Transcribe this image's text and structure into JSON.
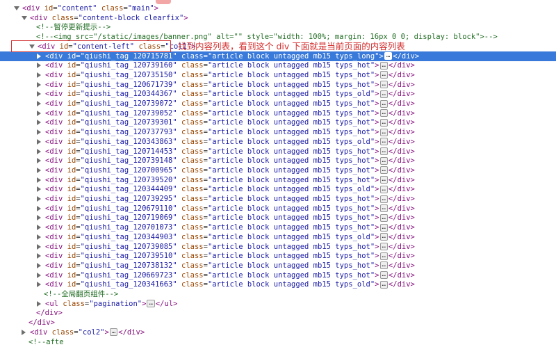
{
  "lines": [
    {
      "indent": 0,
      "tri": "open",
      "kind": "open",
      "tag": "div",
      "attrs": [
        {
          "n": "id",
          "v": "\"content\""
        },
        {
          "n": "class",
          "v": "\"main\""
        }
      ]
    },
    {
      "indent": 1,
      "tri": "open",
      "kind": "open",
      "tag": "div",
      "attrs": [
        {
          "n": "class",
          "v": "\"content-block clearfix\""
        }
      ]
    },
    {
      "indent": 2,
      "tri": "none",
      "kind": "comment",
      "text": "<!--暂停更新提示-->"
    },
    {
      "indent": 2,
      "tri": "none",
      "kind": "comment",
      "text": "<!--<img src=\"/static/images/banner.png\" alt=\"\" style=\"width: 100%; margin: 16px 0 0; display: block\">-->"
    },
    {
      "indent": 2,
      "tri": "open",
      "kind": "open",
      "tag": "div",
      "attrs": [
        {
          "n": "id",
          "v": "\"content-left\""
        },
        {
          "n": "class",
          "v": "\"col1\""
        }
      ]
    },
    {
      "indent": 3,
      "tri": "closed",
      "kind": "collapsed",
      "hl": true,
      "tag": "div",
      "attrs": [
        {
          "n": "id",
          "v": "\"qiushi_tag_120715781\""
        },
        {
          "n": "class",
          "v": "\"article block untagged mb15 typs_long\""
        }
      ]
    },
    {
      "indent": 3,
      "tri": "closed",
      "kind": "collapsed",
      "tag": "div",
      "attrs": [
        {
          "n": "id",
          "v": "\"qiushi_tag_120739160\""
        },
        {
          "n": "class",
          "v": "\"article block untagged mb15 typs_hot\""
        }
      ]
    },
    {
      "indent": 3,
      "tri": "closed",
      "kind": "collapsed",
      "tag": "div",
      "attrs": [
        {
          "n": "id",
          "v": "\"qiushi_tag_120735150\""
        },
        {
          "n": "class",
          "v": "\"article block untagged mb15 typs_hot\""
        }
      ]
    },
    {
      "indent": 3,
      "tri": "closed",
      "kind": "collapsed",
      "tag": "div",
      "attrs": [
        {
          "n": "id",
          "v": "\"qiushi_tag_120671739\""
        },
        {
          "n": "class",
          "v": "\"article block untagged mb15 typs_hot\""
        }
      ]
    },
    {
      "indent": 3,
      "tri": "closed",
      "kind": "collapsed",
      "tag": "div",
      "attrs": [
        {
          "n": "id",
          "v": "\"qiushi_tag_120344367\""
        },
        {
          "n": "class",
          "v": "\"article block untagged mb15 typs_old\""
        }
      ]
    },
    {
      "indent": 3,
      "tri": "closed",
      "kind": "collapsed",
      "tag": "div",
      "attrs": [
        {
          "n": "id",
          "v": "\"qiushi_tag_120739072\""
        },
        {
          "n": "class",
          "v": "\"article block untagged mb15 typs_hot\""
        }
      ]
    },
    {
      "indent": 3,
      "tri": "closed",
      "kind": "collapsed",
      "tag": "div",
      "attrs": [
        {
          "n": "id",
          "v": "\"qiushi_tag_120739052\""
        },
        {
          "n": "class",
          "v": "\"article block untagged mb15 typs_hot\""
        }
      ]
    },
    {
      "indent": 3,
      "tri": "closed",
      "kind": "collapsed",
      "tag": "div",
      "attrs": [
        {
          "n": "id",
          "v": "\"qiushi_tag_120739301\""
        },
        {
          "n": "class",
          "v": "\"article block untagged mb15 typs_hot\""
        }
      ]
    },
    {
      "indent": 3,
      "tri": "closed",
      "kind": "collapsed",
      "tag": "div",
      "attrs": [
        {
          "n": "id",
          "v": "\"qiushi_tag_120737793\""
        },
        {
          "n": "class",
          "v": "\"article block untagged mb15 typs_hot\""
        }
      ]
    },
    {
      "indent": 3,
      "tri": "closed",
      "kind": "collapsed",
      "tag": "div",
      "attrs": [
        {
          "n": "id",
          "v": "\"qiushi_tag_120343863\""
        },
        {
          "n": "class",
          "v": "\"article block untagged mb15 typs_old\""
        }
      ]
    },
    {
      "indent": 3,
      "tri": "closed",
      "kind": "collapsed",
      "tag": "div",
      "attrs": [
        {
          "n": "id",
          "v": "\"qiushi_tag_120714453\""
        },
        {
          "n": "class",
          "v": "\"article block untagged mb15 typs_hot\""
        }
      ]
    },
    {
      "indent": 3,
      "tri": "closed",
      "kind": "collapsed",
      "tag": "div",
      "attrs": [
        {
          "n": "id",
          "v": "\"qiushi_tag_120739148\""
        },
        {
          "n": "class",
          "v": "\"article block untagged mb15 typs_hot\""
        }
      ]
    },
    {
      "indent": 3,
      "tri": "closed",
      "kind": "collapsed",
      "tag": "div",
      "attrs": [
        {
          "n": "id",
          "v": "\"qiushi_tag_120700965\""
        },
        {
          "n": "class",
          "v": "\"article block untagged mb15 typs_hot\""
        }
      ]
    },
    {
      "indent": 3,
      "tri": "closed",
      "kind": "collapsed",
      "tag": "div",
      "attrs": [
        {
          "n": "id",
          "v": "\"qiushi_tag_120739520\""
        },
        {
          "n": "class",
          "v": "\"article block untagged mb15 typs_hot\""
        }
      ]
    },
    {
      "indent": 3,
      "tri": "closed",
      "kind": "collapsed",
      "tag": "div",
      "attrs": [
        {
          "n": "id",
          "v": "\"qiushi_tag_120344409\""
        },
        {
          "n": "class",
          "v": "\"article block untagged mb15 typs_old\""
        }
      ]
    },
    {
      "indent": 3,
      "tri": "closed",
      "kind": "collapsed",
      "tag": "div",
      "attrs": [
        {
          "n": "id",
          "v": "\"qiushi_tag_120739295\""
        },
        {
          "n": "class",
          "v": "\"article block untagged mb15 typs_hot\""
        }
      ]
    },
    {
      "indent": 3,
      "tri": "closed",
      "kind": "collapsed",
      "tag": "div",
      "attrs": [
        {
          "n": "id",
          "v": "\"qiushi_tag_120679110\""
        },
        {
          "n": "class",
          "v": "\"article block untagged mb15 typs_hot\""
        }
      ]
    },
    {
      "indent": 3,
      "tri": "closed",
      "kind": "collapsed",
      "tag": "div",
      "attrs": [
        {
          "n": "id",
          "v": "\"qiushi_tag_120719069\""
        },
        {
          "n": "class",
          "v": "\"article block untagged mb15 typs_hot\""
        }
      ]
    },
    {
      "indent": 3,
      "tri": "closed",
      "kind": "collapsed",
      "tag": "div",
      "attrs": [
        {
          "n": "id",
          "v": "\"qiushi_tag_120701073\""
        },
        {
          "n": "class",
          "v": "\"article block untagged mb15 typs_hot\""
        }
      ]
    },
    {
      "indent": 3,
      "tri": "closed",
      "kind": "collapsed",
      "tag": "div",
      "attrs": [
        {
          "n": "id",
          "v": "\"qiushi_tag_120344903\""
        },
        {
          "n": "class",
          "v": "\"article block untagged mb15 typs_old\""
        }
      ]
    },
    {
      "indent": 3,
      "tri": "closed",
      "kind": "collapsed",
      "tag": "div",
      "attrs": [
        {
          "n": "id",
          "v": "\"qiushi_tag_120739085\""
        },
        {
          "n": "class",
          "v": "\"article block untagged mb15 typs_hot\""
        }
      ]
    },
    {
      "indent": 3,
      "tri": "closed",
      "kind": "collapsed",
      "tag": "div",
      "attrs": [
        {
          "n": "id",
          "v": "\"qiushi_tag_120739510\""
        },
        {
          "n": "class",
          "v": "\"article block untagged mb15 typs_hot\""
        }
      ]
    },
    {
      "indent": 3,
      "tri": "closed",
      "kind": "collapsed",
      "tag": "div",
      "attrs": [
        {
          "n": "id",
          "v": "\"qiushi_tag_120738132\""
        },
        {
          "n": "class",
          "v": "\"article block untagged mb15 typs_hot\""
        }
      ]
    },
    {
      "indent": 3,
      "tri": "closed",
      "kind": "collapsed",
      "tag": "div",
      "attrs": [
        {
          "n": "id",
          "v": "\"qiushi_tag_120669723\""
        },
        {
          "n": "class",
          "v": "\"article block untagged mb15 typs_hot\""
        }
      ]
    },
    {
      "indent": 3,
      "tri": "closed",
      "kind": "collapsed",
      "tag": "div",
      "attrs": [
        {
          "n": "id",
          "v": "\"qiushi_tag_120341663\""
        },
        {
          "n": "class",
          "v": "\"article block untagged mb15 typs_old\""
        }
      ]
    },
    {
      "indent": 3,
      "tri": "none",
      "kind": "comment",
      "text": "<!--全局翻页组件-->"
    },
    {
      "indent": 3,
      "tri": "closed",
      "kind": "collapsed",
      "tag": "ul",
      "attrs": [
        {
          "n": "class",
          "v": "\"pagination\""
        }
      ]
    },
    {
      "indent": 2,
      "tri": "none",
      "kind": "close",
      "tag": "div"
    },
    {
      "indent": 1,
      "tri": "none",
      "kind": "close",
      "tag": "div"
    },
    {
      "indent": 1,
      "tri": "closed",
      "kind": "collapsed",
      "tag": "div",
      "attrs": [
        {
          "n": "class",
          "v": "\"col2\""
        }
      ]
    },
    {
      "indent": 1,
      "tri": "none",
      "kind": "comment",
      "text": "<!--afte"
    }
  ],
  "annotation": "找到内容列表，看到这个 div 下面就是当前页面的内容列表",
  "ellipsis": "…",
  "colors": {
    "highlight": "#3879d9",
    "annotation": "#d32f2f",
    "tag": "#881280",
    "attr": "#994500",
    "value": "#1a1aa6",
    "comment": "#236e25"
  }
}
